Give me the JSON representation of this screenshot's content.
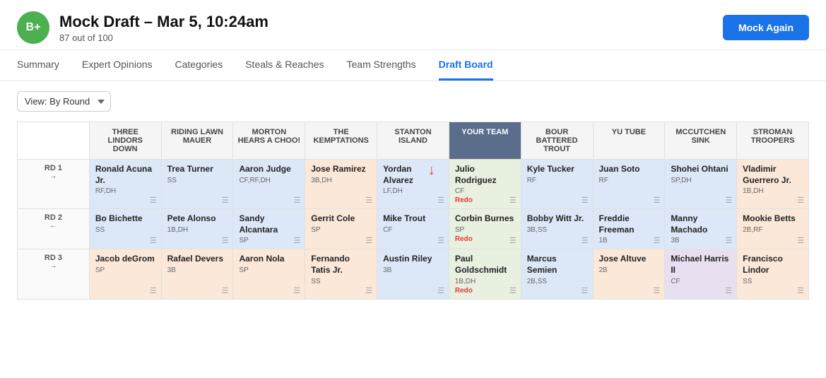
{
  "header": {
    "grade": "B+",
    "title": "Mock Draft – Mar 5, 10:24am",
    "subtitle": "87 out of 100",
    "mock_again": "Mock Again"
  },
  "nav": {
    "items": [
      {
        "label": "Summary",
        "active": false
      },
      {
        "label": "Expert Opinions",
        "active": false
      },
      {
        "label": "Categories",
        "active": false
      },
      {
        "label": "Steals & Reaches",
        "active": false
      },
      {
        "label": "Team Strengths",
        "active": false
      },
      {
        "label": "Draft Board",
        "active": true
      }
    ]
  },
  "toolbar": {
    "view_label": "View: By Round"
  },
  "teams": [
    {
      "name": "THREE LINDORS DOWN"
    },
    {
      "name": "RIDING LAWN MAUER"
    },
    {
      "name": "MORTON HEARS A CHOO!"
    },
    {
      "name": "THE KEMPTATIONS"
    },
    {
      "name": "STANTON ISLAND"
    },
    {
      "name": "YOUR TEAM"
    },
    {
      "name": "BOUR BATTERED TROUT"
    },
    {
      "name": "YU TUBE"
    },
    {
      "name": "MCCUTCHEN SINK"
    },
    {
      "name": "STROMAN TROOPERS"
    }
  ],
  "rounds": [
    {
      "label": "RD 1",
      "arrow": "→",
      "picks": [
        {
          "name": "Ronald Acuna Jr.",
          "pos": "RF,DH",
          "style": "blue"
        },
        {
          "name": "Trea Turner",
          "pos": "SS",
          "style": "blue"
        },
        {
          "name": "Aaron Judge",
          "pos": "CF,RF,DH",
          "style": "blue"
        },
        {
          "name": "Jose Ramirez",
          "pos": "3B,DH",
          "style": "peach"
        },
        {
          "name": "Yordan Alvarez",
          "pos": "LF,DH",
          "style": "blue"
        },
        {
          "name": "Julio Rodriguez",
          "pos": "CF",
          "note": "Redo",
          "style": "your-team"
        },
        {
          "name": "Kyle Tucker",
          "pos": "RF",
          "style": "blue"
        },
        {
          "name": "Juan Soto",
          "pos": "RF",
          "style": "blue"
        },
        {
          "name": "Shohei Ohtani",
          "pos": "SP,DH",
          "style": "blue"
        },
        {
          "name": "Vladimir Guerrero Jr.",
          "pos": "1B,DH",
          "style": "peach"
        }
      ]
    },
    {
      "label": "RD 2",
      "arrow": "←",
      "picks": [
        {
          "name": "Bo Bichette",
          "pos": "SS",
          "style": "blue"
        },
        {
          "name": "Pete Alonso",
          "pos": "1B,DH",
          "style": "blue"
        },
        {
          "name": "Sandy Alcantara",
          "pos": "SP",
          "style": "blue"
        },
        {
          "name": "Gerrit Cole",
          "pos": "SP",
          "style": "peach"
        },
        {
          "name": "Mike Trout",
          "pos": "CF",
          "style": "blue"
        },
        {
          "name": "Corbin Burnes",
          "pos": "SP",
          "note": "Redo",
          "style": "your-team"
        },
        {
          "name": "Bobby Witt Jr.",
          "pos": "3B,SS",
          "style": "blue"
        },
        {
          "name": "Freddie Freeman",
          "pos": "1B",
          "style": "blue"
        },
        {
          "name": "Manny Machado",
          "pos": "3B",
          "style": "blue"
        },
        {
          "name": "Mookie Betts",
          "pos": "2B,RF",
          "style": "peach"
        }
      ]
    },
    {
      "label": "RD 3",
      "arrow": "→",
      "picks": [
        {
          "name": "Jacob deGrom",
          "pos": "SP",
          "style": "peach"
        },
        {
          "name": "Rafael Devers",
          "pos": "3B",
          "style": "peach"
        },
        {
          "name": "Aaron Nola",
          "pos": "SP",
          "style": "peach"
        },
        {
          "name": "Fernando Tatis Jr.",
          "pos": "SS",
          "style": "peach"
        },
        {
          "name": "Austin Riley",
          "pos": "3B",
          "style": "blue"
        },
        {
          "name": "Paul Goldschmidt",
          "pos": "1B,DH",
          "note": "Redo",
          "style": "your-team"
        },
        {
          "name": "Marcus Semien",
          "pos": "2B,SS",
          "style": "blue"
        },
        {
          "name": "Jose Altuve",
          "pos": "2B",
          "style": "peach"
        },
        {
          "name": "Michael Harris II",
          "pos": "CF",
          "style": "gray"
        },
        {
          "name": "Francisco Lindor",
          "pos": "SS",
          "style": "peach"
        }
      ]
    }
  ]
}
